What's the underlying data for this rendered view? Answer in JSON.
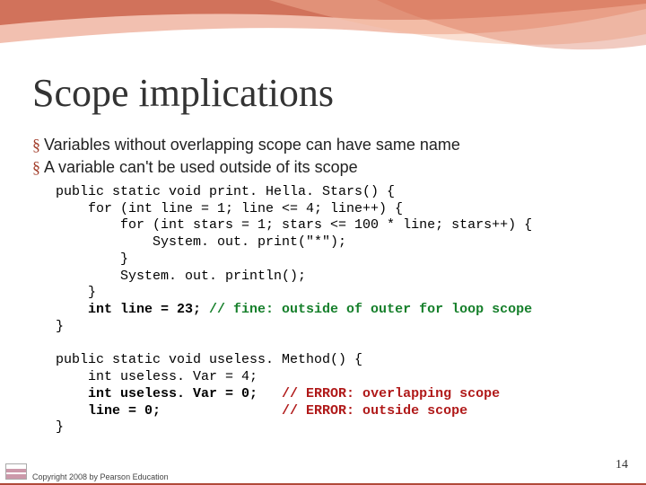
{
  "title": "Scope implications",
  "bullets": [
    "Variables without overlapping scope can have same name",
    "A variable can't be used outside of its scope"
  ],
  "code": {
    "l1": "public static void print. Hella. Stars() {",
    "l2": "    for (int line = 1; line <= 4; line++) {",
    "l3": "        for (int stars = 1; stars <= 100 * line; stars++) {",
    "l4": "            System. out. print(\"*\");",
    "l5": "        }",
    "l6": "        System. out. println();",
    "l7": "    }",
    "l8a": "    int line = 23; ",
    "l8b": "// fine: outside of outer for loop scope",
    "l9": "}",
    "l10": "public static void useless. Method() {",
    "l11": "    int useless. Var = 4;",
    "l12a": "    int useless. Var = 0;   ",
    "l12b": "// ERROR: overlapping scope",
    "l13a": "    line = 0;               ",
    "l13b": "// ERROR: outside scope",
    "l14": "}"
  },
  "footer": "Copyright 2008 by Pearson Education",
  "pagenum": "14",
  "bullet_glyph": "§"
}
